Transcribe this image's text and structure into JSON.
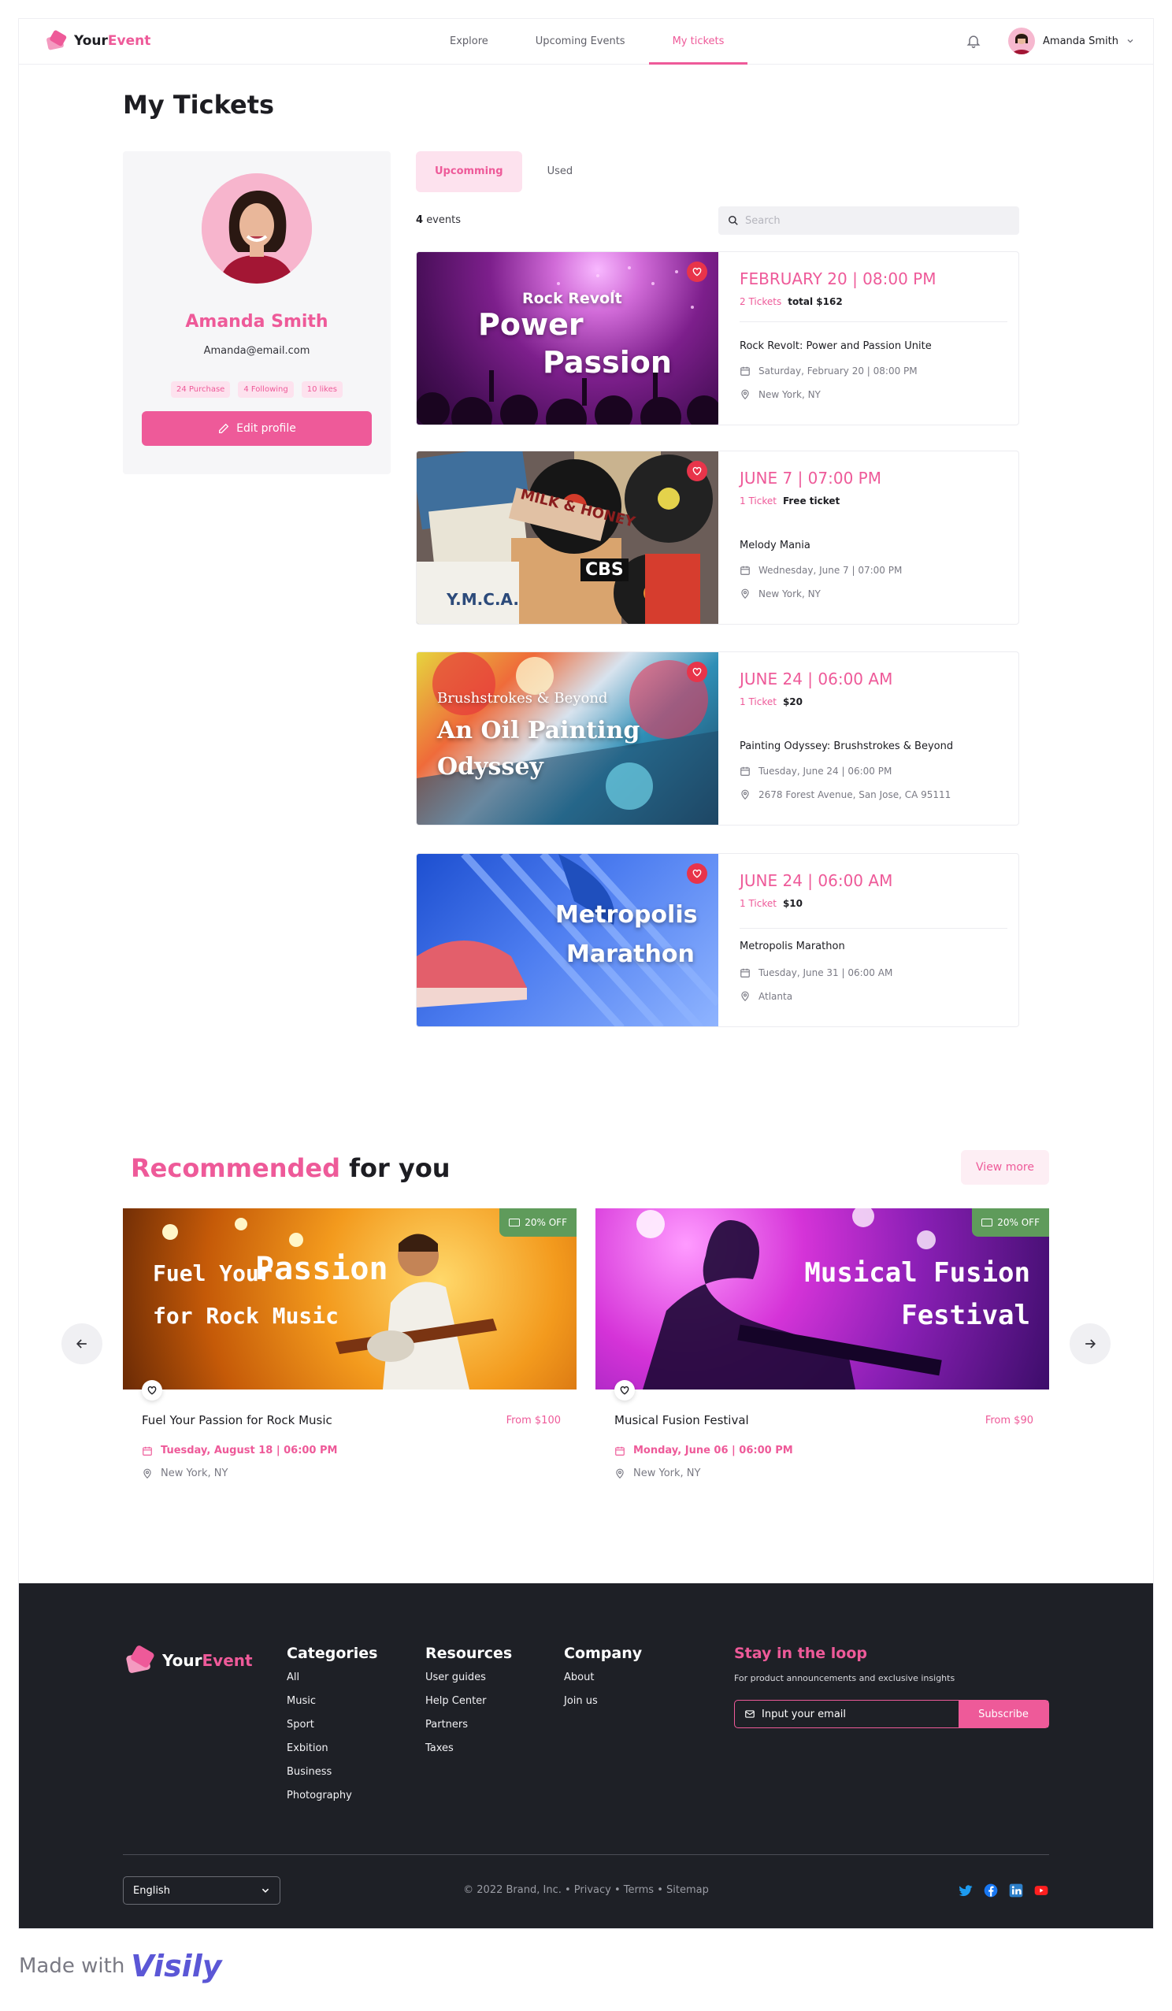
{
  "brand": {
    "name_a": "Your",
    "name_b": "Event"
  },
  "nav": {
    "items": [
      {
        "label": "Explore"
      },
      {
        "label": "Upcoming Events"
      },
      {
        "label": "My tickets"
      }
    ]
  },
  "user": {
    "name": "Amanda Smith"
  },
  "page": {
    "title": "My Tickets"
  },
  "profile": {
    "name": "Amanda Smith",
    "email": "Amanda@email.com",
    "chips": [
      "24 Purchase",
      "4 Following",
      "10 likes"
    ],
    "edit_label": "Edit profile"
  },
  "tabs": [
    "Upcomming",
    "Used"
  ],
  "events_count": {
    "number": "4",
    "label": "events"
  },
  "search": {
    "placeholder": "Search"
  },
  "tickets": [
    {
      "image_text": [
        "Rock Revolt",
        "Power",
        "Passion"
      ],
      "date": "FEBRUARY 20 | 08:00 PM",
      "qty": "2 Tickets",
      "price": "total $162",
      "name": "Rock Revolt: Power and Passion Unite",
      "datetime": "Saturday, February 20 | 08:00 PM",
      "location": "New York, NY"
    },
    {
      "image_text": [
        "MILK & HONEY",
        "CBS",
        "Y.M.C.A."
      ],
      "date": "JUNE 7 | 07:00 PM",
      "qty": "1 Ticket",
      "price": "Free ticket",
      "name": "Melody Mania",
      "datetime": "Wednesday, June 7 | 07:00 PM",
      "location": "New York, NY"
    },
    {
      "image_text": [
        "Brushstrokes & Beyond",
        "An Oil Painting",
        "Odyssey"
      ],
      "date": "JUNE 24 | 06:00 AM",
      "qty": "1 Ticket",
      "price": "$20",
      "name": "Painting Odyssey: Brushstrokes & Beyond",
      "datetime": "Tuesday, June 24 | 06:00 PM",
      "location": "2678 Forest Avenue, San Jose, CA 95111"
    },
    {
      "image_text": [
        "Metropolis",
        "Marathon"
      ],
      "date": "JUNE 24 | 06:00 AM",
      "qty": "1 Ticket",
      "price": "$10",
      "name": "Metropolis Marathon",
      "datetime": "Tuesday, June 31 | 06:00 AM",
      "location": "Atlanta"
    }
  ],
  "recommended": {
    "title_a": "Recommended",
    "title_b": "for you",
    "view_more": "View more",
    "cards": [
      {
        "image_text": [
          "Fuel Your",
          "Passion",
          "for Rock Music"
        ],
        "badge": "20% OFF",
        "name": "Fuel Your Passion for Rock Music",
        "price": "From $100",
        "date": "Tuesday, August 18 | 06:00 PM",
        "location": "New York, NY"
      },
      {
        "image_text": [
          "Musical Fusion",
          "Festival"
        ],
        "badge": "20% OFF",
        "name": "Musical Fusion Festival",
        "price": "From $90",
        "date": "Monday, June 06 | 06:00 PM",
        "location": "New York, NY"
      }
    ]
  },
  "footer": {
    "categories": {
      "title": "Categories",
      "links": [
        "All",
        "Music",
        "Sport",
        "Exbition",
        "Business",
        "Photography"
      ]
    },
    "resources": {
      "title": "Resources",
      "links": [
        "User guides",
        "Help Center",
        "Partners",
        "Taxes"
      ]
    },
    "company": {
      "title": "Company",
      "links": [
        "About",
        "Join us"
      ]
    },
    "loop": {
      "title": "Stay in the loop",
      "text": "For product announcements and exclusive insights",
      "placeholder": "Input your email",
      "button": "Subscribe"
    },
    "language": "English",
    "copyright": "© 2022 Brand, Inc.  •  Privacy  •  Terms  •  Sitemap"
  },
  "made_with": {
    "text": "Made with",
    "brand": "Visily"
  },
  "colors": {
    "accent": "#ee5a99",
    "dark": "#1e2026",
    "badge": "#5f9b5b",
    "heart": "#e8344a"
  }
}
